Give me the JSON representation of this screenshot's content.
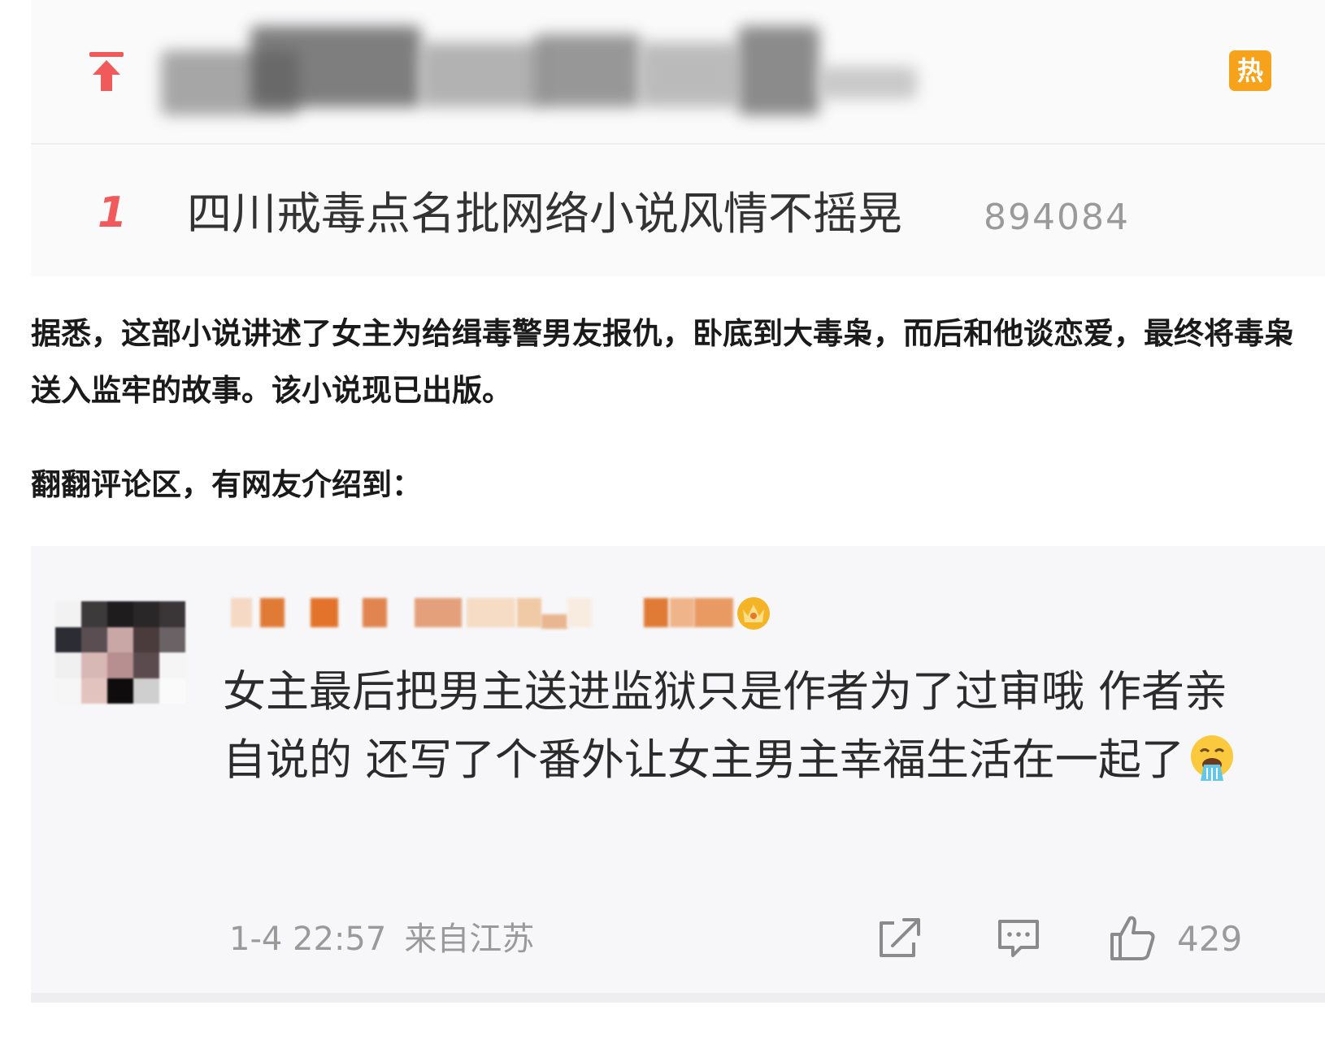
{
  "hot_search": {
    "pinned": {
      "icon": "pinned-top-arrow-icon",
      "badge": "热"
    },
    "first": {
      "rank": "1",
      "title": "四川戒毒点名批网络小说风情不摇晃",
      "count": "894084"
    }
  },
  "article": {
    "paragraph_1": "据悉，这部小说讲述了女主为给缉毒警男友报仇，卧底到大毒枭，而后和他谈恋爱，最终将毒枭送入监牢的故事。该小说现已出版。",
    "paragraph_2": "翻翻评论区，有网友介绍到："
  },
  "comment": {
    "text": "女主最后把男主送进监狱只是作者为了过审哦  作者亲自说的  还写了个番外让女主男主幸福生活在一起了",
    "emoji": "vomit-emoji",
    "time": "1-4 22:57",
    "location": "来自江苏",
    "likes": "429"
  },
  "colors": {
    "rank_red": "#f05a5a",
    "hot_badge": "#f7a21b",
    "meta_gray": "#9a9a9a",
    "card_bg": "#f7f7f9"
  }
}
